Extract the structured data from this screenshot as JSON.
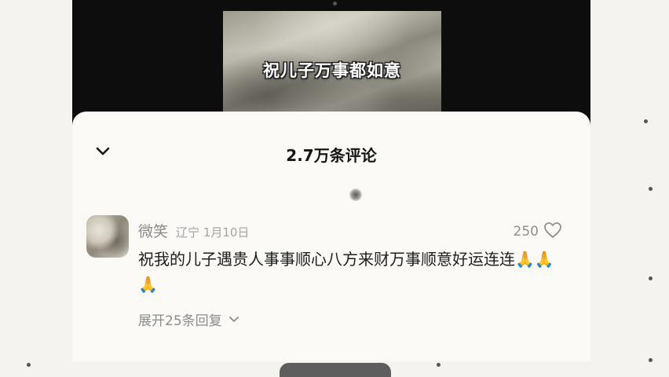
{
  "video": {
    "caption": "祝儿子万事都如意"
  },
  "comments_sheet": {
    "title": "2.7万条评论",
    "collapse_icon": "chevron-down-icon"
  },
  "comment": {
    "username": "微笑",
    "location_date": "辽宁 1月10日",
    "like_count": "250",
    "like_icon": "heart-outline-icon",
    "text": "祝我的儿子遇贵人事事顺心八方来财万事顺意好运连连🙏🙏🙏",
    "expand_label": "展开25条回复",
    "expand_icon": "chevron-down-icon"
  }
}
